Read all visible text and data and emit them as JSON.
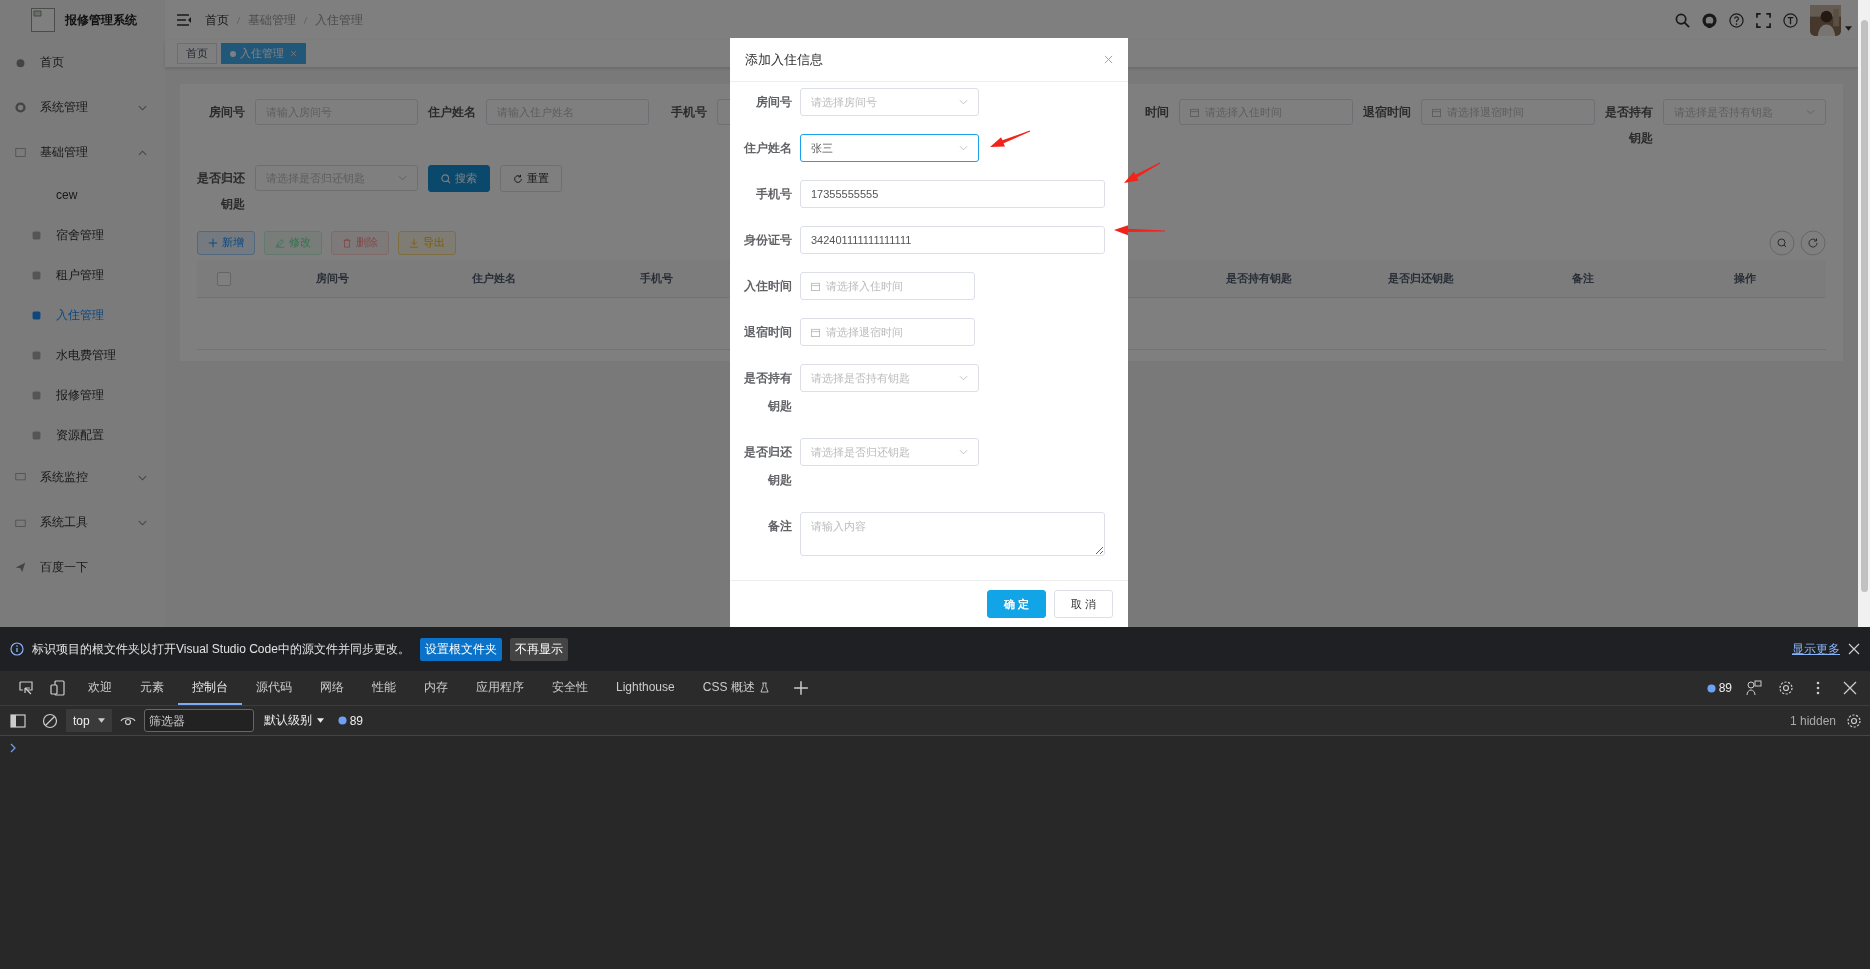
{
  "header": {
    "logo_title": "报修管理系统",
    "breadcrumb": [
      "首页",
      "基础管理",
      "入住管理"
    ]
  },
  "sidebar": {
    "items": [
      {
        "label": "首页",
        "kind": "link",
        "selected": false
      },
      {
        "label": "系统管理",
        "kind": "group",
        "selected": false,
        "expanded": false
      },
      {
        "label": "基础管理",
        "kind": "group",
        "selected": false,
        "expanded": true,
        "children": [
          {
            "label": "cew",
            "selected": false
          },
          {
            "label": "宿舍管理",
            "selected": false
          },
          {
            "label": "租户管理",
            "selected": false
          },
          {
            "label": "入住管理",
            "selected": true
          },
          {
            "label": "水电费管理",
            "selected": false
          },
          {
            "label": "报修管理",
            "selected": false
          },
          {
            "label": "资源配置",
            "selected": false
          }
        ]
      },
      {
        "label": "系统监控",
        "kind": "group",
        "selected": false,
        "expanded": false
      },
      {
        "label": "系统工具",
        "kind": "group",
        "selected": false,
        "expanded": false
      },
      {
        "label": "百度一下",
        "kind": "link",
        "selected": false
      }
    ]
  },
  "tabs": [
    {
      "label": "首页",
      "selected": false,
      "closable": false
    },
    {
      "label": "入住管理",
      "selected": true,
      "closable": true
    }
  ],
  "search_form": {
    "rows": [
      [
        {
          "label": "房间号",
          "kind": "input",
          "placeholder": "请输入房间号"
        },
        {
          "label": "住户姓名",
          "kind": "input",
          "placeholder": "请输入住户姓名"
        },
        {
          "label": "手机号",
          "kind": "input"
        },
        {
          "label": "时间",
          "kind": "date",
          "placeholder": "请选择入住时间"
        },
        {
          "label": "退宿时间",
          "kind": "date",
          "placeholder": "请选择退宿时间"
        },
        {
          "label": "是否持有钥匙",
          "kind": "select",
          "placeholder": "请选择是否持有钥匙"
        }
      ],
      [
        {
          "label": "是否归还钥匙",
          "kind": "select",
          "placeholder": "请选择是否归还钥匙"
        }
      ]
    ],
    "buttons": [
      {
        "label": "搜索",
        "kind": "primary"
      },
      {
        "label": "重置",
        "kind": "default"
      }
    ]
  },
  "toolbar": {
    "buttons": [
      {
        "label": "新增",
        "kind": "add",
        "disabled": false
      },
      {
        "label": "修改",
        "kind": "edit",
        "disabled": true
      },
      {
        "label": "删除",
        "kind": "delete",
        "disabled": true
      },
      {
        "label": "导出",
        "kind": "export",
        "disabled": false
      }
    ]
  },
  "table": {
    "columns": [
      "房间号",
      "住户姓名",
      "手机号",
      "是否持有钥匙",
      "是否归还钥匙",
      "备注",
      "操作"
    ],
    "select_all_checked": false
  },
  "dialog": {
    "title": "添加入住信息",
    "fields": [
      {
        "label": "房间号",
        "kind": "select",
        "placeholder": "请选择房间号",
        "focused": false
      },
      {
        "label": "住户姓名",
        "kind": "select",
        "value": "张三",
        "focused": true
      },
      {
        "label": "手机号",
        "kind": "input",
        "value": "17355555555",
        "focused": false
      },
      {
        "label": "身份证号",
        "kind": "input",
        "value": "342401111111111111",
        "focused": false
      },
      {
        "label": "入住时间",
        "kind": "date",
        "placeholder": "请选择入住时间",
        "focused": false
      },
      {
        "label": "退宿时间",
        "kind": "date",
        "placeholder": "请选择退宿时间",
        "focused": false
      },
      {
        "label": "是否持有钥匙",
        "kind": "select",
        "placeholder": "请选择是否持有钥匙",
        "focused": false
      },
      {
        "label": "是否归还钥匙",
        "kind": "select",
        "placeholder": "请选择是否归还钥匙",
        "focused": false
      },
      {
        "label": "备注",
        "kind": "textarea",
        "placeholder": "请输入内容",
        "focused": false
      }
    ],
    "buttons": [
      {
        "label": "确 定",
        "kind": "primary"
      },
      {
        "label": "取 消",
        "kind": "default"
      }
    ]
  },
  "devtools": {
    "infobar": {
      "message": "标识项目的根文件夹以打开Visual Studio Code中的源文件并同步更改。",
      "buttons": [
        {
          "label": "设置根文件夹",
          "kind": "primary"
        },
        {
          "label": "不再显示",
          "kind": "default"
        }
      ],
      "link": "显示更多"
    },
    "tabs": [
      {
        "label": "欢迎",
        "selected": false,
        "experimental": false
      },
      {
        "label": "元素",
        "selected": false,
        "experimental": false
      },
      {
        "label": "控制台",
        "selected": true,
        "experimental": false
      },
      {
        "label": "源代码",
        "selected": false,
        "experimental": false
      },
      {
        "label": "网络",
        "selected": false,
        "experimental": false
      },
      {
        "label": "性能",
        "selected": false,
        "experimental": false
      },
      {
        "label": "内存",
        "selected": false,
        "experimental": false
      },
      {
        "label": "应用程序",
        "selected": false,
        "experimental": false
      },
      {
        "label": "安全性",
        "selected": false,
        "experimental": false
      },
      {
        "label": "Lighthouse",
        "selected": false,
        "experimental": false
      },
      {
        "label": "CSS 概述",
        "selected": false,
        "experimental": true
      }
    ],
    "issues_count": "89",
    "console": {
      "context": "top",
      "filter_placeholder": "筛选器",
      "level": "默认级别",
      "messages_count": "89",
      "hidden": "1 hidden"
    }
  }
}
